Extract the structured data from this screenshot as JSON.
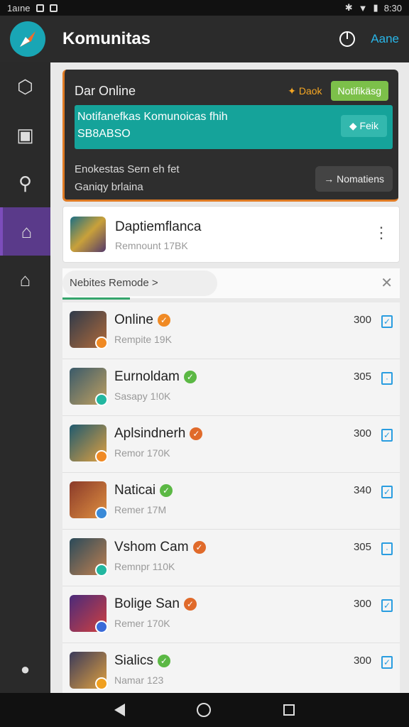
{
  "status_bar": {
    "carrier": "1aıne",
    "time": "8:30"
  },
  "app_bar": {
    "title": "Komunitas",
    "link": "Aane"
  },
  "online_card": {
    "title": "Dar Online",
    "back_label": "Daok",
    "notif_label": "Notifikäsg",
    "banner_line1": "Notifanefkas Komunoicas fhih",
    "banner_line2": "SB8ABSO",
    "fork_label": "Feik",
    "text_line1": "Enokestas Sern eh fet",
    "text_line2": "Ganiqy brlaina",
    "notifications_button": "Nomatiens"
  },
  "feature_card": {
    "title": "Daptiemflanca",
    "subtitle": "Remnount 17BK"
  },
  "filter": {
    "label": "Nebites Remode >"
  },
  "list": [
    {
      "name": "Online",
      "sub": "Rempite 19K",
      "count": "300",
      "status_color": "#f08a24",
      "badge_color": "#f08a24",
      "avatar_colors": [
        "#2f3a4a",
        "#b06a3a"
      ],
      "checked": true
    },
    {
      "name": "Eurnoldam",
      "sub": "Sasapy 1!0K",
      "count": "305",
      "status_color": "#5bb844",
      "badge_color": "#22b7a0",
      "avatar_colors": [
        "#3a5a6a",
        "#c0a060"
      ],
      "checked": false
    },
    {
      "name": "Aplsindnerh",
      "sub": "Remor 170K",
      "count": "300",
      "status_color": "#e06a2a",
      "badge_color": "#f08a24",
      "avatar_colors": [
        "#1f5a6f",
        "#e0a040"
      ],
      "checked": true
    },
    {
      "name": "Naticai",
      "sub": "Remer 17M",
      "count": "340",
      "status_color": "#5bb844",
      "badge_color": "#3a8ad8",
      "avatar_colors": [
        "#8a3a2a",
        "#e09040"
      ],
      "checked": true
    },
    {
      "name": "Vshom Cam",
      "sub": "Remnpr 110K",
      "count": "305",
      "status_color": "#e06a2a",
      "badge_color": "#22b7a0",
      "avatar_colors": [
        "#2a4a5a",
        "#c08050"
      ],
      "checked": false
    },
    {
      "name": "Bolige San",
      "sub": "Remer 170K",
      "count": "300",
      "status_color": "#e06a2a",
      "badge_color": "#3a6ad8",
      "avatar_colors": [
        "#4a2a7a",
        "#d04040"
      ],
      "checked": true
    },
    {
      "name": "Sialics",
      "sub": "Namar 123",
      "count": "300",
      "status_color": "#5bb844",
      "badge_color": "#f0a020",
      "avatar_colors": [
        "#3a3a5a",
        "#e0a040"
      ],
      "checked": true
    }
  ]
}
